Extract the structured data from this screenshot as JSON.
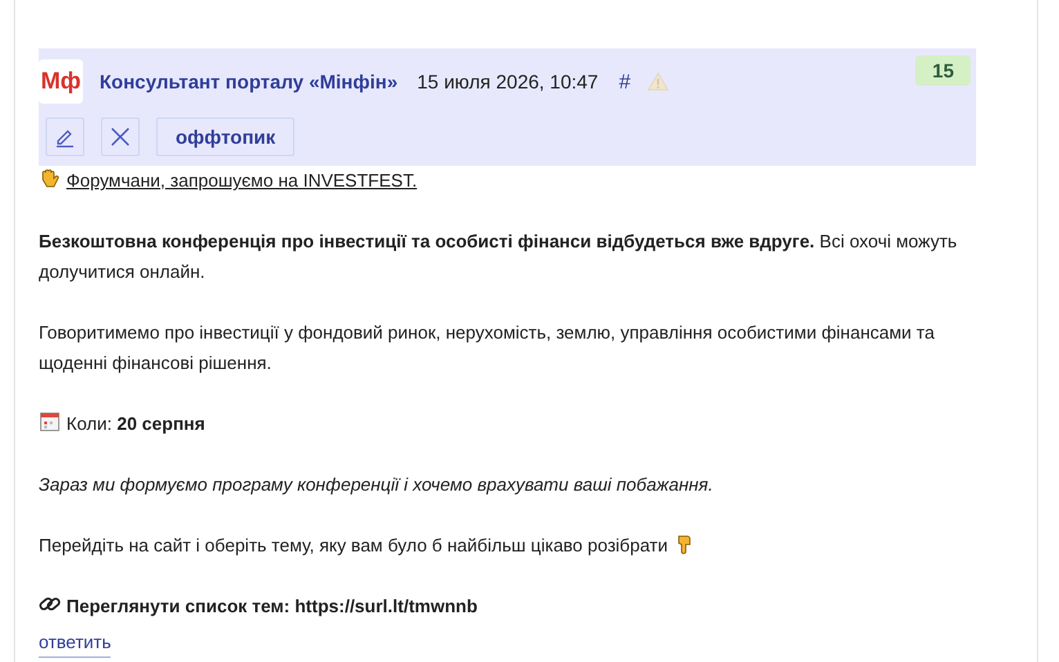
{
  "post": {
    "logo": "Мф",
    "author": "Консультант порталу «Мінфін»",
    "date": "15 июля 2026, 10:47",
    "anchor": "#",
    "score": "15",
    "tag_button": "оффтопик"
  },
  "body": [
    {
      "kind": "link",
      "text": "Форумчани, запрошуємо на INVESTFEST."
    },
    {
      "kind": "text",
      "text": "**Безкоштовна конференція про інвестиції та особисті фінанси відбудеться вже вдруге.** Всі охочі можуть долучитися онлайн."
    },
    {
      "kind": "text",
      "text": "Говоритимемо про інвестиції у фондовий ринок, нерухомість, землю, управління особистими фінансами та щоденні фінансові рішення."
    },
    {
      "kind": "dated",
      "text": "Коли: **20 серпня**"
    },
    {
      "kind": "italic",
      "text": "Зараз ми формуємо програму конференції і хочемо врахувати ваші побажання."
    },
    {
      "kind": "pointer",
      "text": "Перейдіть на сайт і оберіть тему, яку вам було б найбільш цікаво розібрати"
    },
    {
      "kind": "clip",
      "text": "Переглянути список тем: https://surl.lt/tmwnnb"
    }
  ],
  "reply_link": "ответить"
}
